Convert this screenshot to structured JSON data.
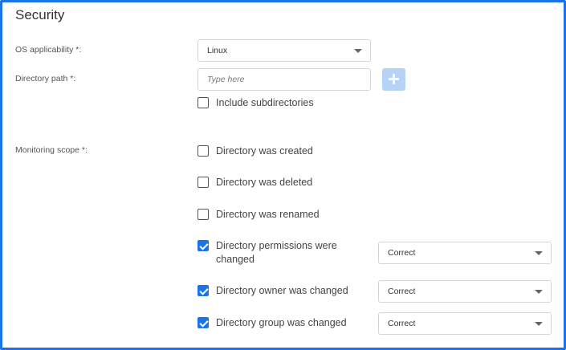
{
  "section": {
    "title": "Security"
  },
  "os": {
    "label": "OS applicability *:",
    "value": "Linux"
  },
  "directory": {
    "label": "Directory path *:",
    "placeholder": "Type here"
  },
  "include_sub": {
    "label": "Include subdirectories",
    "checked": false
  },
  "monitoring": {
    "label": "Monitoring scope *:",
    "items": [
      {
        "label": "Directory was created",
        "checked": false
      },
      {
        "label": "Directory was deleted",
        "checked": false
      },
      {
        "label": "Directory was renamed",
        "checked": false
      },
      {
        "label": "Directory permissions were changed",
        "checked": true,
        "select": "Correct"
      },
      {
        "label": "Directory owner was changed",
        "checked": true,
        "select": "Correct"
      },
      {
        "label": "Directory group was changed",
        "checked": true,
        "select": "Correct"
      }
    ]
  },
  "colors": {
    "accent": "#1a73e8",
    "add_button": "#b6d3f7"
  },
  "icons": {
    "add": "plus-icon",
    "dropdown": "chevron-down-icon"
  }
}
